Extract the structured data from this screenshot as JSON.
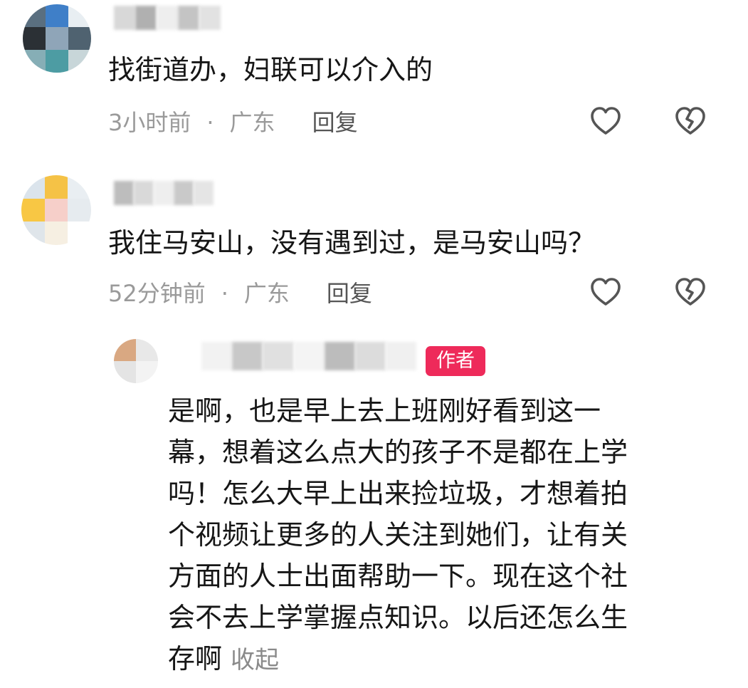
{
  "colors": {
    "text_primary": "#161616",
    "meta_gray": "#9a9a9a",
    "reply_gray": "#555555",
    "icon_gray": "#555555",
    "author_badge_bg": "#ee2a5a",
    "collapse_gray": "#8a8a8a"
  },
  "comments": [
    {
      "avatar_tiles": [
        "#5a6f80",
        "#3f7fc8",
        "#e8eef2",
        "#2b3035",
        "#8fa5b8",
        "#4f6270",
        "#86aeb6",
        "#4d9ca3",
        "#c8d6d9"
      ],
      "username_tiles": [
        "#d8d8d8",
        "#b0b0b0",
        "#eeeeee",
        "#c4c4c4",
        "#e2e2e2"
      ],
      "text": "找街道办，妇联可以介入的",
      "time": "3小时前",
      "separator": "·",
      "location": "广东",
      "reply_label": "回复",
      "like_icon": "heart-outline-icon",
      "dislike_icon": "broken-heart-icon"
    },
    {
      "avatar_tiles": [
        "#dbe4ec",
        "#f5c246",
        "#e9eef2",
        "#f8c744",
        "#f6cfc9",
        "#e6ebef",
        "#dfe5ea",
        "#f6efe2",
        "#ffffff"
      ],
      "username_tiles": [
        "#bdbdbd",
        "#d9d9d9",
        "#eeeeee",
        "#c9c9c9",
        "#e5e5e5"
      ],
      "text": "我住马安山，没有遇到过，是马安山吗？",
      "time": "52分钟前",
      "separator": "·",
      "location": "广东",
      "reply_label": "回复",
      "like_icon": "heart-outline-icon",
      "dislike_icon": "broken-heart-icon"
    }
  ],
  "author_reply": {
    "avatar_tiles": [
      "#d9a882",
      "#e8e8e8",
      "#e4e4e4",
      "#f3f3f3"
    ],
    "username_tiles": [
      "#ffffff",
      "#f2f2f2",
      "#c8c8c8",
      "#e0e0e0",
      "#f4f4f4",
      "#bcbcbc",
      "#dcdcdc",
      "#f0f0f0"
    ],
    "badge": "作者",
    "lines": [
      "是啊，也是早上去上班刚好看到这一",
      "幕，想着这么点大的孩子不是都在上学",
      "吗！怎么大早上出来捡垃圾，才想着拍",
      "个视频让更多的人关注到她们，让有关",
      "方面的人士出面帮助一下。现在这个社",
      "会不去上学掌握点知识。以后还怎么生",
      "存啊"
    ],
    "collapse_label": "收起"
  }
}
